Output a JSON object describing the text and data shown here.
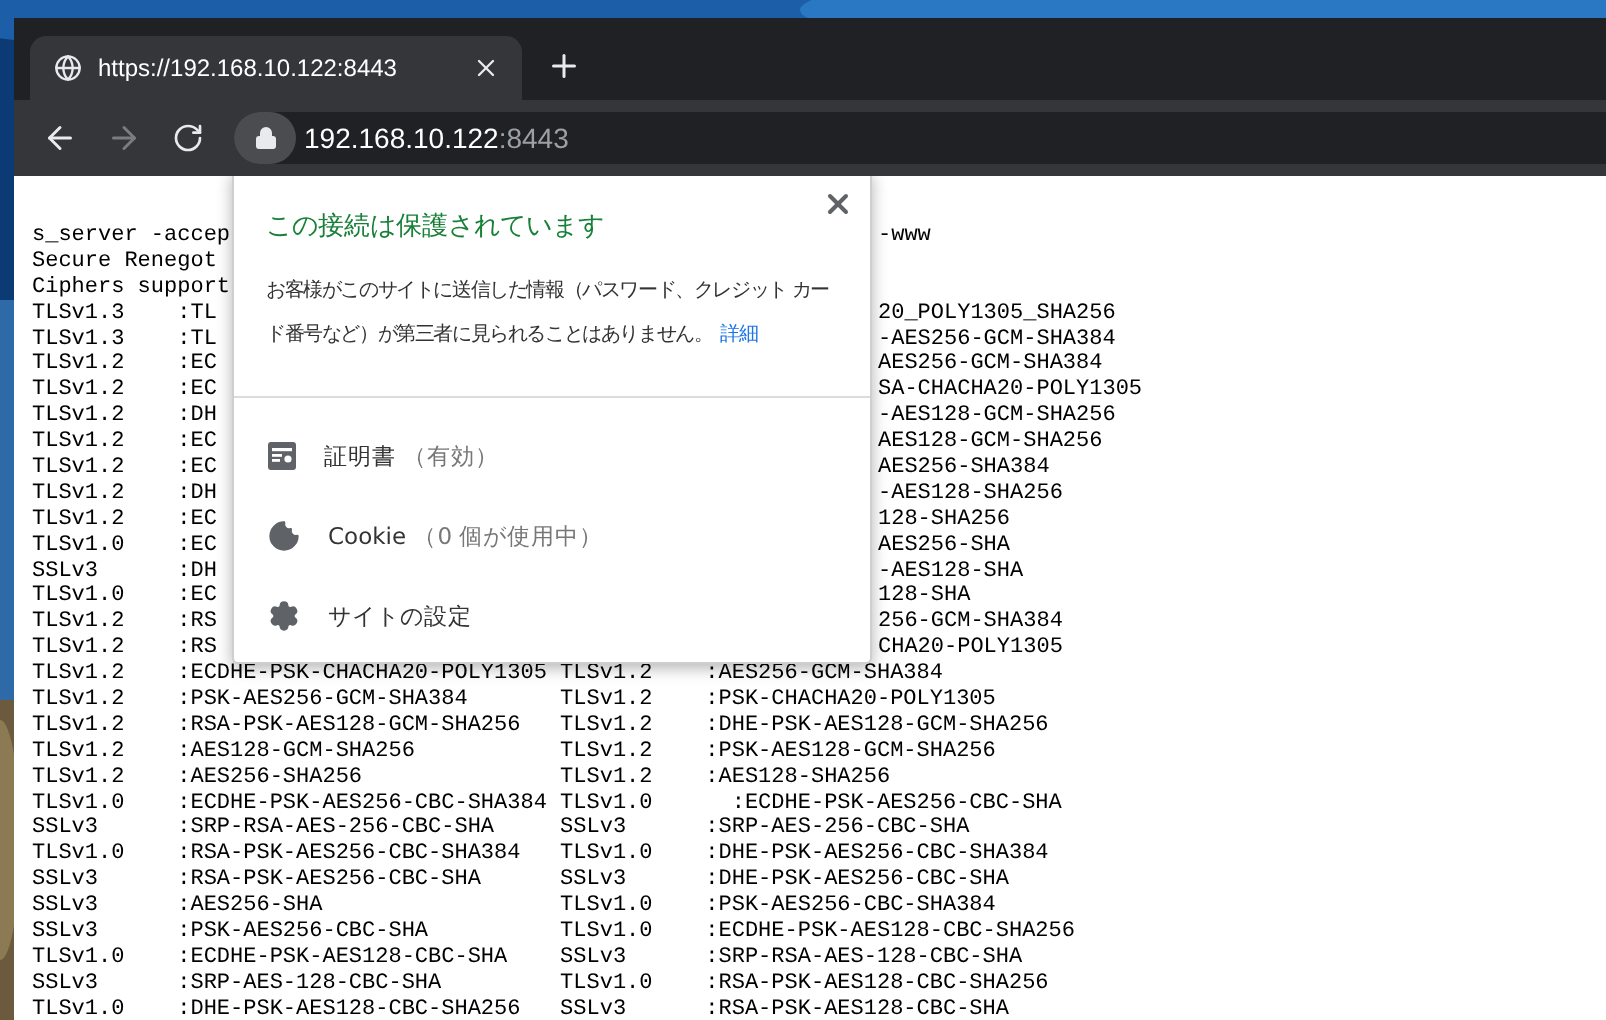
{
  "browser": {
    "tab": {
      "title": "https://192.168.10.122:8443"
    },
    "address": {
      "host": "192.168.10.122",
      "port": ":8443"
    }
  },
  "popup": {
    "title": "この接続は保護されています",
    "description": "お客様がこのサイトに送信した情報（パスワード、クレジット カード番号など）が第三者に見られることはありません。",
    "link": "詳細",
    "items": [
      {
        "kind": "certificate",
        "label": "証明書",
        "detail": "（有効）"
      },
      {
        "kind": "cookie",
        "label": "Cookie",
        "detail": "（0 個が使用中）"
      },
      {
        "kind": "settings",
        "label": "サイトの設定"
      }
    ]
  },
  "terminal": {
    "lines": [
      {
        "kind": "split",
        "left": "s_server -accep",
        "right": "-www"
      },
      {
        "kind": "split",
        "left": "Secure Renegot"
      },
      {
        "kind": "split",
        "left": "Ciphers support"
      },
      {
        "kind": "split",
        "left": "TLSv1.3    :TL",
        "right": "20_POLY1305_SHA256"
      },
      {
        "kind": "split",
        "left": "TLSv1.3    :TL",
        "right": "-AES256-GCM-SHA384"
      },
      {
        "kind": "split",
        "left": "TLSv1.2    :EC",
        "right": "AES256-GCM-SHA384"
      },
      {
        "kind": "split",
        "left": "TLSv1.2    :EC",
        "right": "SA-CHACHA20-POLY1305"
      },
      {
        "kind": "split",
        "left": "TLSv1.2    :DH",
        "right": "-AES128-GCM-SHA256"
      },
      {
        "kind": "split",
        "left": "TLSv1.2    :EC",
        "right": "AES128-GCM-SHA256"
      },
      {
        "kind": "split",
        "left": "TLSv1.2    :EC",
        "right": "AES256-SHA384"
      },
      {
        "kind": "split",
        "left": "TLSv1.2    :DH",
        "right": "-AES128-SHA256"
      },
      {
        "kind": "split",
        "left": "TLSv1.2    :EC",
        "right": "128-SHA256"
      },
      {
        "kind": "split",
        "left": "TLSv1.0    :EC",
        "right": "AES256-SHA"
      },
      {
        "kind": "split",
        "left": "SSLv3      :DH",
        "right": "-AES128-SHA"
      },
      {
        "kind": "split",
        "left": "TLSv1.0    :EC",
        "right": "128-SHA"
      },
      {
        "kind": "split",
        "left": "TLSv1.2    :RS",
        "right": "256-GCM-SHA384"
      },
      {
        "kind": "split",
        "left": "TLSv1.2    :RS",
        "right": "CHA20-POLY1305"
      },
      {
        "kind": "full",
        "text": "TLSv1.2    :ECDHE-PSK-CHACHA20-POLY1305 TLSv1.2    :AES256-GCM-SHA384"
      },
      {
        "kind": "full",
        "text": "TLSv1.2    :PSK-AES256-GCM-SHA384       TLSv1.2    :PSK-CHACHA20-POLY1305"
      },
      {
        "kind": "full",
        "text": "TLSv1.2    :RSA-PSK-AES128-GCM-SHA256   TLSv1.2    :DHE-PSK-AES128-GCM-SHA256"
      },
      {
        "kind": "full",
        "text": "TLSv1.2    :AES128-GCM-SHA256           TLSv1.2    :PSK-AES128-GCM-SHA256"
      },
      {
        "kind": "full",
        "text": "TLSv1.2    :AES256-SHA256               TLSv1.2    :AES128-SHA256"
      },
      {
        "kind": "full",
        "text": "TLSv1.0    :ECDHE-PSK-AES256-CBC-SHA384 TLSv1.0      :ECDHE-PSK-AES256-CBC-SHA"
      },
      {
        "kind": "full",
        "text": "SSLv3      :SRP-RSA-AES-256-CBC-SHA     SSLv3      :SRP-AES-256-CBC-SHA"
      },
      {
        "kind": "full",
        "text": "TLSv1.0    :RSA-PSK-AES256-CBC-SHA384   TLSv1.0    :DHE-PSK-AES256-CBC-SHA384"
      },
      {
        "kind": "full",
        "text": "SSLv3      :RSA-PSK-AES256-CBC-SHA      SSLv3      :DHE-PSK-AES256-CBC-SHA"
      },
      {
        "kind": "full",
        "text": "SSLv3      :AES256-SHA                  TLSv1.0    :PSK-AES256-CBC-SHA384"
      },
      {
        "kind": "full",
        "text": "SSLv3      :PSK-AES256-CBC-SHA          TLSv1.0    :ECDHE-PSK-AES128-CBC-SHA256"
      },
      {
        "kind": "full",
        "text": "TLSv1.0    :ECDHE-PSK-AES128-CBC-SHA    SSLv3      :SRP-RSA-AES-128-CBC-SHA"
      },
      {
        "kind": "full",
        "text": "SSLv3      :SRP-AES-128-CBC-SHA         TLSv1.0    :RSA-PSK-AES128-CBC-SHA256"
      },
      {
        "kind": "full",
        "text": "TLSv1.0    :DHE-PSK-AES128-CBC-SHA256   SSLv3      :RSA-PSK-AES128-CBC-SHA"
      }
    ]
  }
}
